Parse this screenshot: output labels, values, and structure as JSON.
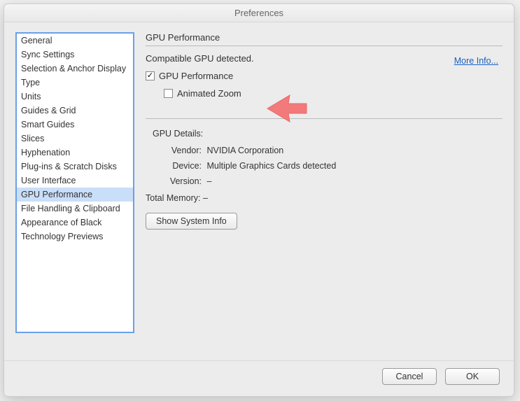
{
  "window": {
    "title": "Preferences"
  },
  "sidebar": {
    "items": [
      {
        "label": "General"
      },
      {
        "label": "Sync Settings"
      },
      {
        "label": "Selection & Anchor Display"
      },
      {
        "label": "Type"
      },
      {
        "label": "Units"
      },
      {
        "label": "Guides & Grid"
      },
      {
        "label": "Smart Guides"
      },
      {
        "label": "Slices"
      },
      {
        "label": "Hyphenation"
      },
      {
        "label": "Plug-ins & Scratch Disks"
      },
      {
        "label": "User Interface"
      },
      {
        "label": "GPU Performance",
        "selected": true
      },
      {
        "label": "File Handling & Clipboard"
      },
      {
        "label": "Appearance of Black"
      },
      {
        "label": "Technology Previews"
      }
    ]
  },
  "main": {
    "section_title": "GPU Performance",
    "compat_text": "Compatible GPU detected.",
    "more_info": "More Info...",
    "gpu_perf_checkbox": {
      "label": "GPU Performance",
      "checked": true
    },
    "animated_zoom_checkbox": {
      "label": "Animated Zoom",
      "checked": false
    },
    "details_title": "GPU Details:",
    "vendor_label": "Vendor:",
    "vendor_value": "NVIDIA Corporation",
    "device_label": "Device:",
    "device_value": "Multiple Graphics Cards detected",
    "version_label": "Version:",
    "version_value": "–",
    "total_memory_label": "Total Memory:",
    "total_memory_value": "–",
    "show_system_info": "Show System Info"
  },
  "footer": {
    "cancel": "Cancel",
    "ok": "OK"
  },
  "arrow_color": "#f27a7a"
}
